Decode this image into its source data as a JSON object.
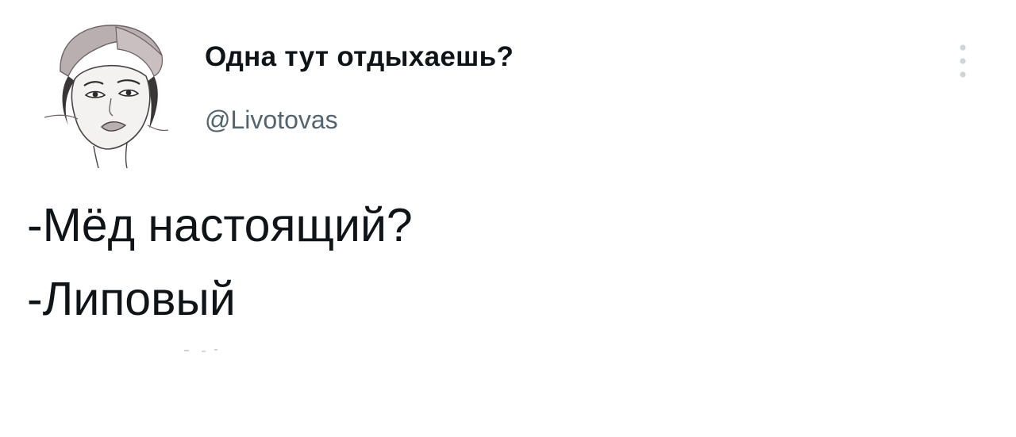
{
  "tweet": {
    "author": {
      "display_name": "Одна тут отдыхаешь?",
      "handle": "@Livotovas",
      "avatar_icon": "avatar-illustration"
    },
    "more_icon": "more-vertical-icon",
    "text_lines": [
      "-Мёд настоящий?",
      "-Липовый"
    ]
  },
  "colors": {
    "background": "#ffffff",
    "primary_text": "#0f1419",
    "secondary_text": "#536471",
    "icon_gray": "#cfd4d8"
  }
}
